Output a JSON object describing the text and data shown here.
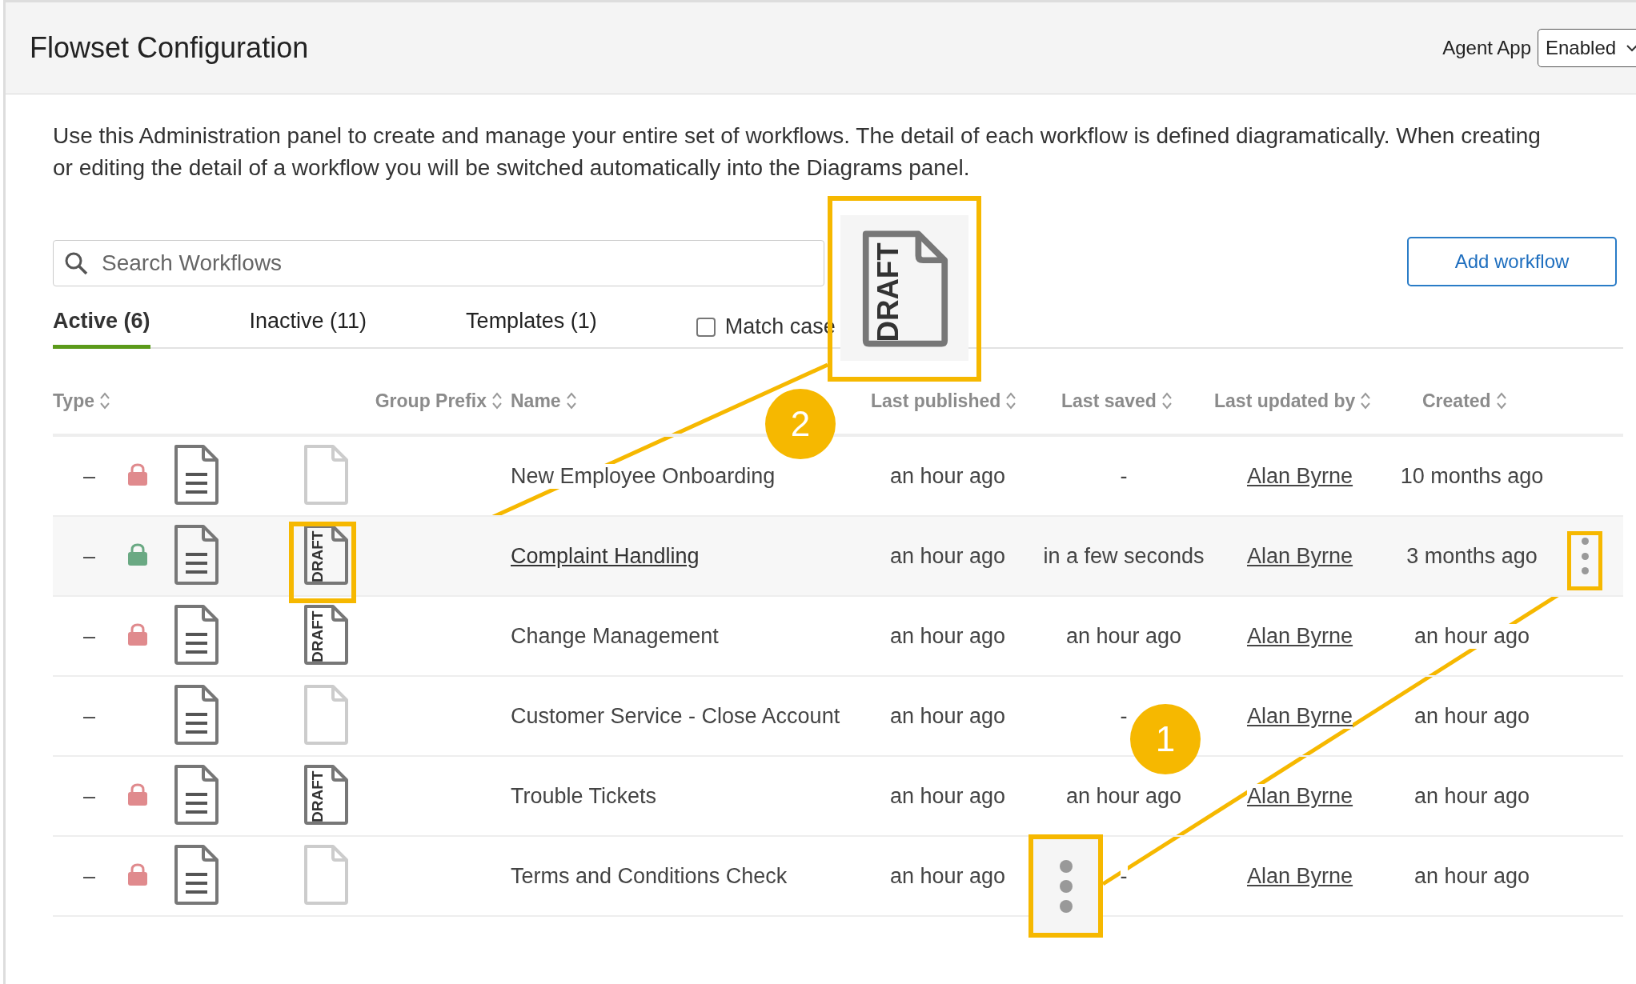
{
  "header": {
    "title": "Flowset Configuration",
    "agent_app_label": "Agent App",
    "agent_app_value": "Enabled"
  },
  "description": "Use this Administration panel to create and manage your entire set of workflows. The detail of each workflow is defined diagramatically. When creating or editing the detail of a workflow you will be switched automatically into the Diagrams panel.",
  "search": {
    "placeholder": "Search Workflows"
  },
  "add_button": "Add workflow",
  "tabs": [
    {
      "label": "Active (6)",
      "selected": true
    },
    {
      "label": "Inactive (11)",
      "selected": false
    },
    {
      "label": "Templates (1)",
      "selected": false
    }
  ],
  "match_case": {
    "label": "Match case",
    "checked": false
  },
  "columns": [
    "Type",
    "Group Prefix",
    "Name",
    "Last published",
    "Last saved",
    "Last updated by",
    "Created"
  ],
  "rows": [
    {
      "type": "–",
      "color": "#e08a8d",
      "draft": false,
      "name": "New Employee Onboarding",
      "last_published": "an hour ago",
      "last_saved": "-",
      "updated_by": "Alan Byrne",
      "created": "10 months ago",
      "selected": false
    },
    {
      "type": "–",
      "color": "#6aa983",
      "draft": true,
      "draft_label": "DRAFT",
      "name": "Complaint Handling",
      "last_published": "an hour ago",
      "last_saved": "in a few seconds",
      "updated_by": "Alan Byrne",
      "created": "3 months ago",
      "selected": true
    },
    {
      "type": "–",
      "color": "#e08a8d",
      "draft": true,
      "draft_label": "DRAFT",
      "name": "Change Management",
      "last_published": "an hour ago",
      "last_saved": "an hour ago",
      "updated_by": "Alan Byrne",
      "created": "an hour ago",
      "selected": false
    },
    {
      "type": "–",
      "draft": false,
      "name": "Customer Service - Close Account",
      "last_published": "an hour ago",
      "last_saved": "-",
      "updated_by": "Alan Byrne",
      "created": "an hour ago",
      "selected": false
    },
    {
      "type": "–",
      "color": "#e08a8d",
      "draft": true,
      "draft_label": "DRAFT",
      "name": "Trouble Tickets",
      "last_published": "an hour ago",
      "last_saved": "an hour ago",
      "updated_by": "Alan Byrne",
      "created": "an hour ago",
      "selected": false
    },
    {
      "type": "–",
      "color": "#e08a8d",
      "draft": false,
      "name": "Terms and Conditions Check",
      "last_published": "an hour ago",
      "last_saved": "-",
      "updated_by": "Alan Byrne",
      "created": "an hour ago",
      "selected": false
    }
  ],
  "callouts": [
    {
      "number": "2",
      "kind": "draft",
      "draft_label": "DRAFT"
    },
    {
      "number": "1",
      "kind": "menu"
    }
  ]
}
